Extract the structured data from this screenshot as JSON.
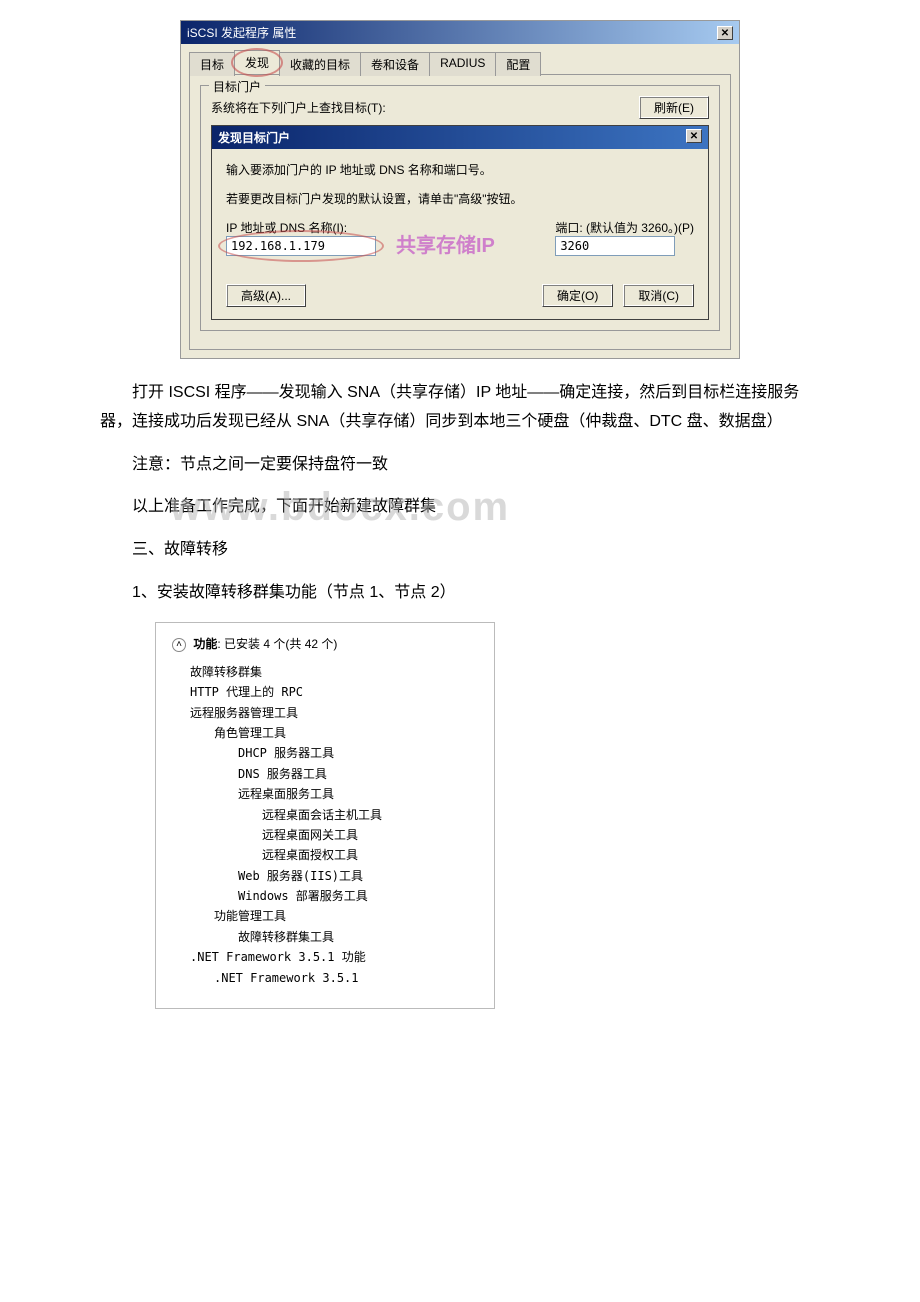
{
  "dialog1": {
    "title": "iSCSI 发起程序 属性",
    "tabs": {
      "target": "目标",
      "discover": "发现",
      "favorites": "收藏的目标",
      "volumes": "卷和设备",
      "radius": "RADIUS",
      "config": "配置"
    },
    "portal_group_legend": "目标门户",
    "search_text": "系统将在下列门户上查找目标(T):",
    "refresh_btn": "刷新(E)",
    "inner": {
      "title": "发现目标门户",
      "hint1": "输入要添加门户的 IP 地址或 DNS 名称和端口号。",
      "hint2": "若要更改目标门户发现的默认设置，请单击\"高级\"按钮。",
      "ip_label": "IP 地址或 DNS 名称(I):",
      "port_label": "端口: (默认值为 3260。)(P)",
      "ip_value": "192.168.1.179",
      "port_value": "3260",
      "watermark": "共享存储IP",
      "adv_btn": "高级(A)...",
      "ok_btn": "确定(O)",
      "cancel_btn": "取消(C)"
    }
  },
  "para1": "打开 ISCSI 程序——发现输入 SNA（共享存储）IP 地址——确定连接，然后到目标栏连接服务器，连接成功后发现已经从 SNA（共享存储）同步到本地三个硬盘（仲裁盘、DTC 盘、数据盘）",
  "note": "注意：节点之间一定要保持盘符一致",
  "para2": "以上准备工作完成，下面开始新建故障群集",
  "h3": "三、故障转移",
  "step1": "1、安装故障转移群集功能（节点 1、节点 2）",
  "watermark_big": "www.bdocx.com",
  "features": {
    "header_bold": "功能",
    "header_rest": ": 已安装 4 个(共 42 个)",
    "items": [
      {
        "lvl": 0,
        "t": "故障转移群集"
      },
      {
        "lvl": 0,
        "t": "HTTP 代理上的 RPC"
      },
      {
        "lvl": 0,
        "t": "远程服务器管理工具"
      },
      {
        "lvl": 1,
        "t": "角色管理工具"
      },
      {
        "lvl": 2,
        "t": "DHCP 服务器工具"
      },
      {
        "lvl": 2,
        "t": "DNS 服务器工具"
      },
      {
        "lvl": 2,
        "t": "远程桌面服务工具"
      },
      {
        "lvl": 3,
        "t": "远程桌面会话主机工具"
      },
      {
        "lvl": 3,
        "t": "远程桌面网关工具"
      },
      {
        "lvl": 3,
        "t": "远程桌面授权工具"
      },
      {
        "lvl": 2,
        "t": "Web 服务器(IIS)工具"
      },
      {
        "lvl": 2,
        "t": "Windows 部署服务工具"
      },
      {
        "lvl": 1,
        "t": "功能管理工具"
      },
      {
        "lvl": 2,
        "t": "故障转移群集工具"
      },
      {
        "lvl": 0,
        "t": ".NET Framework 3.5.1 功能"
      },
      {
        "lvl": 1,
        "t": ".NET Framework 3.5.1"
      }
    ]
  }
}
